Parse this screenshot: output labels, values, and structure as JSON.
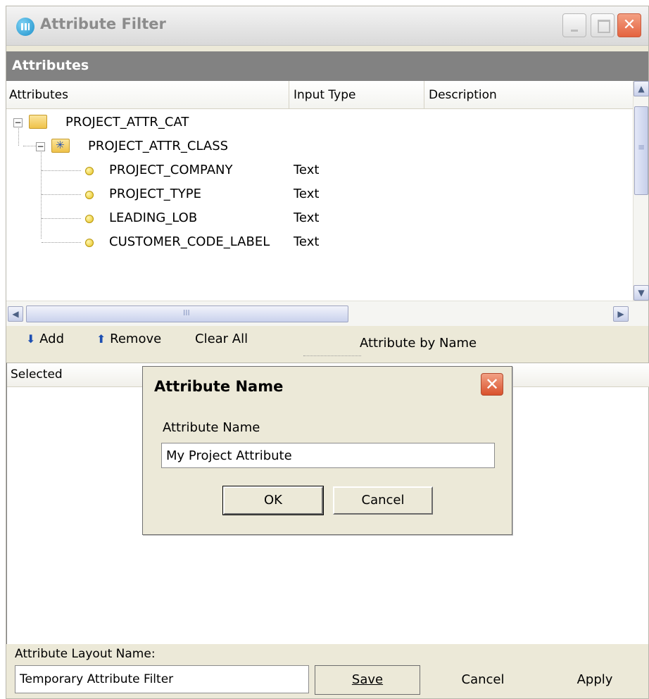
{
  "window": {
    "title": "Attribute Filter"
  },
  "attributes_section": {
    "header": "Attributes",
    "columns": [
      "Attributes",
      "Input Type",
      "Description"
    ]
  },
  "tree": {
    "category": {
      "label": "PROJECT_ATTR_CAT",
      "icon": "folder-open-icon"
    },
    "class": {
      "label": "PROJECT_ATTR_CLASS",
      "icon": "attribute-class-icon"
    },
    "items": [
      {
        "label": "PROJECT_COMPANY",
        "input_type": "Text"
      },
      {
        "label": "PROJECT_TYPE",
        "input_type": "Text"
      },
      {
        "label": "LEADING_LOB",
        "input_type": "Text"
      },
      {
        "label": "CUSTOMER_CODE_LABEL",
        "input_type": "Text"
      }
    ]
  },
  "toolbar": {
    "add_label": "Add",
    "remove_label": "Remove",
    "clear_all_label": "Clear All",
    "by_name_label": "Attribute by Name"
  },
  "selected_section": {
    "header": "Selected"
  },
  "layout": {
    "label": "Attribute Layout Name:",
    "value": "Temporary Attribute Filter"
  },
  "buttons": {
    "save": "Save",
    "cancel": "Cancel",
    "apply": "Apply"
  },
  "dialog": {
    "title": "Attribute Name",
    "field_label": "Attribute Name",
    "field_value": "My Project Attribute",
    "ok": "OK",
    "cancel": "Cancel"
  }
}
